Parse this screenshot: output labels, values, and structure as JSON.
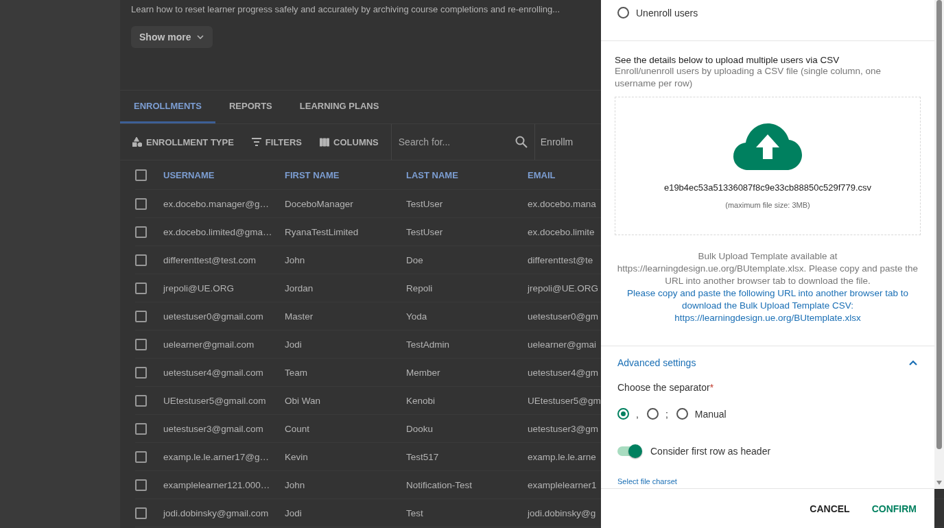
{
  "course": {
    "description": "Learn how to reset learner progress safely and accurately by archiving course completions and re-enrolling...",
    "show_more": "Show more"
  },
  "tabs": [
    {
      "label": "ENROLLMENTS",
      "selected": true
    },
    {
      "label": "REPORTS",
      "selected": false
    },
    {
      "label": "LEARNING PLANS",
      "selected": false
    }
  ],
  "toolbar": {
    "buttons": [
      {
        "label": "ENROLLMENT TYPE",
        "kind": "type"
      },
      {
        "label": "FILTERS",
        "kind": "filter"
      },
      {
        "label": "COLUMNS",
        "kind": "columns"
      }
    ],
    "search": {
      "placeholder": "Search for..."
    },
    "dropdown": "Enrollm"
  },
  "table": {
    "all_checked": false,
    "columns": [
      "USERNAME",
      "FIRST NAME",
      "LAST NAME",
      "EMAIL"
    ],
    "rows": [
      {
        "checked": false,
        "cells": [
          "ex.docebo.manager@g…",
          "DoceboManager",
          "TestUser",
          "ex.docebo.mana"
        ]
      },
      {
        "checked": false,
        "cells": [
          "ex.docebo.limited@gma…",
          "RyanaTestLimited",
          "TestUser",
          "ex.docebo.limite"
        ]
      },
      {
        "checked": false,
        "cells": [
          "differenttest@test.com",
          "John",
          "Doe",
          "differenttest@te"
        ]
      },
      {
        "checked": false,
        "cells": [
          "jrepoli@UE.ORG",
          "Jordan",
          "Repoli",
          "jrepoli@UE.ORG"
        ]
      },
      {
        "checked": false,
        "cells": [
          "uetestuser0@gmail.com",
          "Master",
          "Yoda",
          "uetestuser0@gm"
        ]
      },
      {
        "checked": false,
        "cells": [
          "uelearner@gmail.com",
          "Jodi",
          "TestAdmin",
          "uelearner@gmai"
        ]
      },
      {
        "checked": false,
        "cells": [
          "uetestuser4@gmail.com",
          "Team",
          "Member",
          "uetestuser4@gm"
        ]
      },
      {
        "checked": false,
        "cells": [
          "UEtestuser5@gmail.com",
          "Obi Wan",
          "Kenobi",
          "UEtestuser5@gm"
        ]
      },
      {
        "checked": false,
        "cells": [
          "uetestuser3@gmail.com",
          "Count",
          "Dooku",
          "uetestuser3@gm"
        ]
      },
      {
        "checked": false,
        "cells": [
          "examp.le.le.arner17@g…",
          "Kevin",
          "Test517",
          "examp.le.le.arne"
        ]
      },
      {
        "checked": false,
        "cells": [
          "examplelearner121.000…",
          "John",
          "Notification-Test",
          "examplelearner1"
        ]
      },
      {
        "checked": false,
        "cells": [
          "jodi.dobinsky@gmail.com",
          "Jodi",
          "Test",
          "jodi.dobinsky@g"
        ]
      }
    ]
  },
  "panel": {
    "action": {
      "label": "Unenroll users",
      "selected": false
    },
    "csv_title": "See the details below to upload multiple users via CSV",
    "csv_description": "Enroll/unenroll users by uploading a CSV file (single column, one username per row)",
    "upload": {
      "filename": "e19b4ec53a51336087f8c9e33cb88850c529f779.csv",
      "limit": "(maximum file size: 3MB)"
    },
    "template_note": "Bulk Upload Template available at https://learningdesign.ue.org/BUtemplate.xlsx. Please copy and paste the URL into another browser tab to download the file.",
    "template_link": "Please copy and paste the following URL into another browser tab to download the Bulk Upload Template CSV: https://learningdesign.ue.org/BUtemplate.xlsx",
    "advanced": {
      "title": "Advanced settings",
      "expanded": true
    },
    "separator": {
      "label": "Choose the separator",
      "required": true,
      "required_mark": "*",
      "options": [
        {
          "label": ",",
          "selected": true
        },
        {
          "label": ";",
          "selected": false
        },
        {
          "label": "Manual",
          "selected": false
        }
      ]
    },
    "header_toggle": {
      "label": "Consider first row as header",
      "on": true
    },
    "charset_link": "Select file charset",
    "buttons": [
      {
        "label": "CANCEL",
        "kind": "secondary"
      },
      {
        "label": "CONFIRM",
        "kind": "primary"
      }
    ]
  }
}
